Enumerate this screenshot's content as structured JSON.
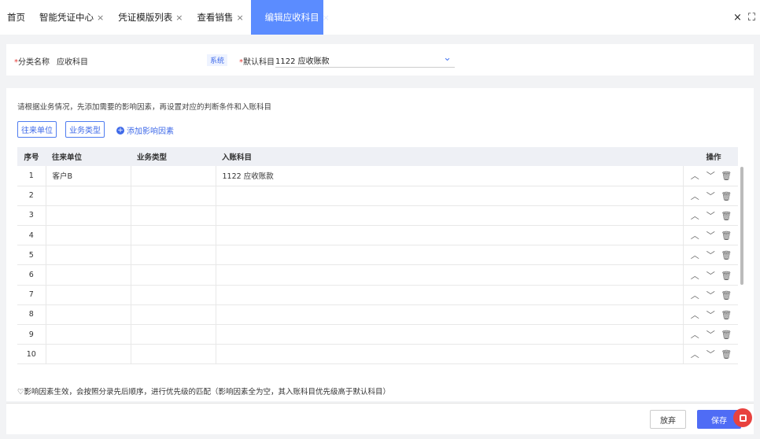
{
  "tabs": [
    {
      "label": "首页",
      "close": ""
    },
    {
      "label": "智能凭证中心",
      "close": "×"
    },
    {
      "label": "凭证模版列表",
      "close": "×"
    },
    {
      "label": "查看销售",
      "close": "×"
    },
    {
      "label": "编辑应收科目",
      "close": "×"
    }
  ],
  "window_actions": {
    "close": "×",
    "fullscreen": "⛶"
  },
  "header": {
    "category_label": "分类名称",
    "category_value": "应收科目",
    "system_badge": "系统",
    "default_account_label": "默认科目",
    "default_account_value": "1122 应收账款",
    "required_mark": "*"
  },
  "factors": {
    "hint": "请根据业务情况，先添加需要的影响因素，再设置对应的判断条件和入账科目",
    "btn_counterparty": "往来单位",
    "btn_business_type": "业务类型",
    "add_factor": "添加影响因素",
    "add_icon": "+"
  },
  "table": {
    "headers": {
      "seq": "序号",
      "counterparty": "往来单位",
      "business_type": "业务类型",
      "account": "入账科目",
      "op": "操作"
    },
    "rows": [
      {
        "seq": "1",
        "counterparty": "客户B",
        "business_type": "",
        "account": "1122 应收账款"
      },
      {
        "seq": "2",
        "counterparty": "",
        "business_type": "",
        "account": ""
      },
      {
        "seq": "3",
        "counterparty": "",
        "business_type": "",
        "account": ""
      },
      {
        "seq": "4",
        "counterparty": "",
        "business_type": "",
        "account": ""
      },
      {
        "seq": "5",
        "counterparty": "",
        "business_type": "",
        "account": ""
      },
      {
        "seq": "6",
        "counterparty": "",
        "business_type": "",
        "account": ""
      },
      {
        "seq": "7",
        "counterparty": "",
        "business_type": "",
        "account": ""
      },
      {
        "seq": "8",
        "counterparty": "",
        "business_type": "",
        "account": ""
      },
      {
        "seq": "9",
        "counterparty": "",
        "business_type": "",
        "account": ""
      },
      {
        "seq": "10",
        "counterparty": "",
        "business_type": "",
        "account": ""
      }
    ],
    "op_icons": {
      "up": "︿",
      "down": "﹀",
      "delete": "🗑"
    }
  },
  "note": "♡影响因素生效，会按照分录先后顺序，进行优先级的匹配（影响因素全为空，其入账科目优先级高于默认科目）",
  "footer": {
    "cancel_label": "放弃",
    "save_label": "保存"
  }
}
